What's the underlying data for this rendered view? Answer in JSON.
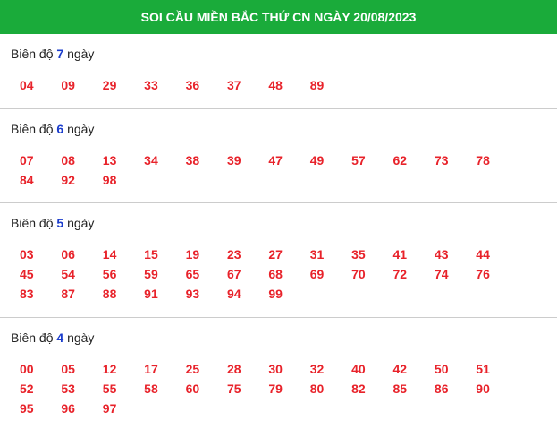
{
  "header": {
    "title": "SOI CẦU MIỀN BẮC THỨ CN NGÀY 20/08/2023"
  },
  "sections": [
    {
      "label_prefix": "Biên độ",
      "days": "7",
      "label_suffix": "ngày",
      "numbers": [
        "04",
        "09",
        "29",
        "33",
        "36",
        "37",
        "48",
        "89"
      ]
    },
    {
      "label_prefix": "Biên độ",
      "days": "6",
      "label_suffix": "ngày",
      "numbers": [
        "07",
        "08",
        "13",
        "34",
        "38",
        "39",
        "47",
        "49",
        "57",
        "62",
        "73",
        "78",
        "84",
        "92",
        "98"
      ]
    },
    {
      "label_prefix": "Biên độ",
      "days": "5",
      "label_suffix": "ngày",
      "numbers": [
        "03",
        "06",
        "14",
        "15",
        "19",
        "23",
        "27",
        "31",
        "35",
        "41",
        "43",
        "44",
        "45",
        "54",
        "56",
        "59",
        "65",
        "67",
        "68",
        "69",
        "70",
        "72",
        "74",
        "76",
        "83",
        "87",
        "88",
        "91",
        "93",
        "94",
        "99"
      ]
    },
    {
      "label_prefix": "Biên độ",
      "days": "4",
      "label_suffix": "ngày",
      "numbers": [
        "00",
        "05",
        "12",
        "17",
        "25",
        "28",
        "30",
        "32",
        "40",
        "42",
        "50",
        "51",
        "52",
        "53",
        "55",
        "58",
        "60",
        "75",
        "79",
        "80",
        "82",
        "85",
        "86",
        "90",
        "95",
        "96",
        "97"
      ]
    }
  ]
}
